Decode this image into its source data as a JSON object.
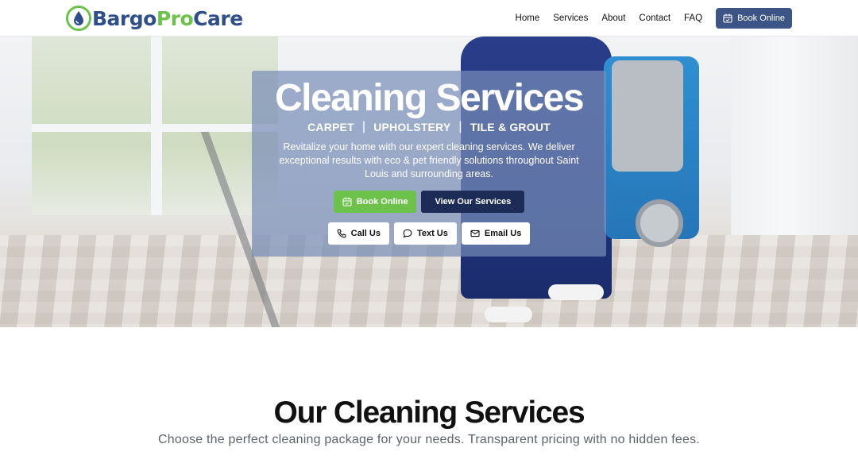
{
  "header": {
    "logo": {
      "part1": "Bargo",
      "part2": "Pro",
      "part3": "Care"
    },
    "nav": [
      "Home",
      "Services",
      "About",
      "Contact",
      "FAQ"
    ],
    "book_label": "Book Online"
  },
  "hero": {
    "title": "Cleaning Services",
    "categories": [
      "CARPET",
      "UPHOLSTERY",
      "TILE & GROUT"
    ],
    "separator": "|",
    "description": "Revitalize your home with our expert cleaning services. We deliver exceptional results with eco & pet friendly solutions throughout Saint Louis and surrounding areas.",
    "book_label": "Book Online",
    "services_label": "View Our Services",
    "call_label": "Call Us",
    "text_label": "Text Us",
    "email_label": "Email Us"
  },
  "services": {
    "title": "Our Cleaning Services",
    "subtitle": "Choose the perfect cleaning package for your needs. Transparent pricing with no hidden fees."
  },
  "colors": {
    "brand_navy": "#3c5586",
    "brand_green": "#6cc24a",
    "dark_navy": "#1c2c56"
  }
}
